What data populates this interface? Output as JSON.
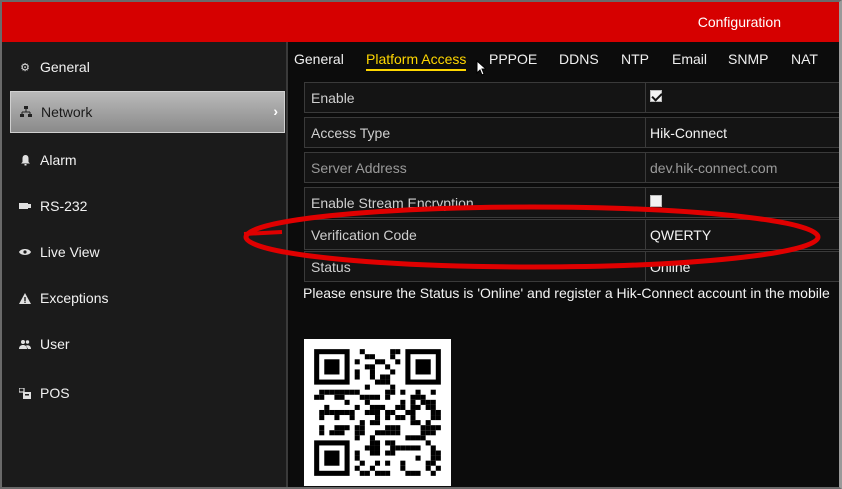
{
  "header": {
    "title": "Configuration"
  },
  "sidebar": {
    "items": [
      {
        "label": "General",
        "icon": "gear-icon",
        "active": false
      },
      {
        "label": "Network",
        "icon": "network-icon",
        "active": true
      },
      {
        "label": "Alarm",
        "icon": "bell-icon",
        "active": false
      },
      {
        "label": "RS-232",
        "icon": "serial-port-icon",
        "active": false
      },
      {
        "label": "Live View",
        "icon": "eye-icon",
        "active": false
      },
      {
        "label": "Exceptions",
        "icon": "warning-icon",
        "active": false
      },
      {
        "label": "User",
        "icon": "users-icon",
        "active": false
      },
      {
        "label": "POS",
        "icon": "pos-terminal-icon",
        "active": false
      }
    ]
  },
  "tabs": [
    {
      "label": "General",
      "active": false
    },
    {
      "label": "Platform Access",
      "active": true
    },
    {
      "label": "PPPOE",
      "active": false
    },
    {
      "label": "DDNS",
      "active": false
    },
    {
      "label": "NTP",
      "active": false
    },
    {
      "label": "Email",
      "active": false
    },
    {
      "label": "SNMP",
      "active": false
    },
    {
      "label": "NAT",
      "active": false
    }
  ],
  "settings": {
    "enable": {
      "label": "Enable",
      "checked": true
    },
    "access_type": {
      "label": "Access Type",
      "value": "Hik-Connect"
    },
    "server_address": {
      "label": "Server Address",
      "value": "dev.hik-connect.com"
    },
    "stream_encryption": {
      "label": "Enable Stream Encryption",
      "checked": false
    },
    "verification_code": {
      "label": "Verification Code",
      "value": "QWERTY"
    },
    "status": {
      "label": "Status",
      "value": "Online"
    }
  },
  "notice": "Please ensure the Status is 'Online' and register a Hik-Connect account in the mobile",
  "colors": {
    "header": "#d60000",
    "active_tab": "#ffd700",
    "highlight_ellipse": "#e00000"
  }
}
